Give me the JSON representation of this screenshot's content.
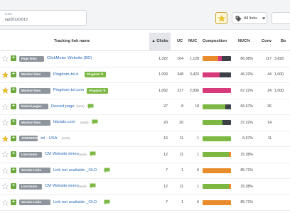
{
  "filter": {
    "date_label": "Date",
    "date_value": "ng/2012/2013"
  },
  "toolbar": {
    "links_label": "All links"
  },
  "table": {
    "columns": {
      "name": "Tracking link name",
      "clicks": "Clicks",
      "uc": "UC",
      "nuc": "NUC",
      "composition": "Composition",
      "nuc_pct": "NUC%",
      "conv": "Conv",
      "last": "Bo"
    },
    "colors": {
      "orange": "#e98a2b",
      "magenta": "#d63a7a",
      "dark": "#3d4147",
      "green": "#7cb843",
      "star": "#f0c419"
    },
    "rows": [
      {
        "starred": false,
        "type": "Page links",
        "name": "ClickMeter Website (BD)",
        "extra": "",
        "comment": false,
        "tag": "",
        "clicks": "1,322",
        "uc": "104",
        "nuc": "1,128",
        "comp": [
          [
            "orange",
            0.55
          ],
          [
            "magenta",
            0.12
          ],
          [
            "dark",
            0.33
          ]
        ],
        "nuc_pct": "86.08%",
        "conv": "117",
        "last": "3,828"
      },
      {
        "starred": true,
        "type": "Monitor links",
        "name": "Pingdom-tnl.it",
        "extra": "",
        "comment": false,
        "tag": "Pingdom",
        "clicks": "1,093",
        "uc": "348",
        "nuc": "3,423",
        "comp": [
          [
            "magenta",
            0.6
          ],
          [
            "dark",
            0.4
          ]
        ],
        "nuc_pct": "46.22%",
        "conv": "44",
        "last": "1,000"
      },
      {
        "starred": true,
        "type": "Monitor links",
        "name": "Pingdom-tnl.com",
        "extra": "",
        "comment": false,
        "tag": "Pingdom",
        "clicks": "1,062",
        "uc": "227",
        "nuc": "2,836",
        "comp": [
          [
            "magenta",
            1.0
          ]
        ],
        "nuc_pct": "67.22%",
        "conv": "24",
        "last": "1,000"
      },
      {
        "starred": false,
        "type": "Denied pages",
        "name": "Denied page",
        "extra": "(web)",
        "comment": true,
        "tag": "",
        "clicks": "27",
        "uc": "8",
        "nuc": "18",
        "comp": [
          [
            "green",
            0.8
          ],
          [
            "dark",
            0.2
          ]
        ],
        "nuc_pct": "66.67%",
        "conv": "36",
        "last": ""
      },
      {
        "starred": false,
        "type": "Monitor links",
        "name": "hitstats.com",
        "extra": "(web)",
        "comment": true,
        "tag": "",
        "clicks": "20",
        "uc": "20",
        "nuc": "",
        "comp": [
          [
            "green",
            0.7
          ],
          [
            "dark",
            0.3
          ]
        ],
        "nuc_pct": "37.22%",
        "conv": "14",
        "last": ""
      },
      {
        "starred": true,
        "type": "ADWORDS",
        "name": "tnl - USA",
        "extra": "(web)",
        "comment": false,
        "tag": "",
        "clicks": "16",
        "uc": "11",
        "nuc": "1",
        "comp": [
          [
            "green",
            1.0
          ]
        ],
        "nuc_pct": "6.67%",
        "conv": "11",
        "last": ""
      },
      {
        "starred": false,
        "type": "Live Demo",
        "name": "CM Website demo",
        "extra": "(web)",
        "comment": true,
        "tag": "",
        "clicks": "12",
        "uc": "11",
        "nuc": "1",
        "comp": [
          [
            "green",
            0.92
          ],
          [
            "orange",
            0.08
          ]
        ],
        "nuc_pct": "15.38%",
        "conv": "",
        "last": ""
      },
      {
        "starred": false,
        "type": "Service Links",
        "name": "Link not available _OLD",
        "extra": "",
        "comment": true,
        "tag": "",
        "clicks": "7",
        "uc": "1",
        "nuc": "6",
        "comp": [
          [
            "orange",
            1.0
          ]
        ],
        "nuc_pct": "85.71%",
        "conv": "",
        "last": ""
      },
      {
        "starred": false,
        "type": "Live Demo",
        "name": "CM Website demo",
        "extra": "(web)",
        "comment": true,
        "tag": "",
        "clicks": "12",
        "uc": "11",
        "nuc": "1",
        "comp": [
          [
            "green",
            0.92
          ],
          [
            "orange",
            0.08
          ]
        ],
        "nuc_pct": "15.38%",
        "conv": "",
        "last": ""
      },
      {
        "starred": false,
        "type": "Service Links",
        "name": "Link not available _OLD",
        "extra": "",
        "comment": true,
        "tag": "",
        "clicks": "7",
        "uc": "1",
        "nuc": "6",
        "comp": [
          [
            "orange",
            1.0
          ]
        ],
        "nuc_pct": "85.71%",
        "conv": "",
        "last": ""
      }
    ]
  }
}
